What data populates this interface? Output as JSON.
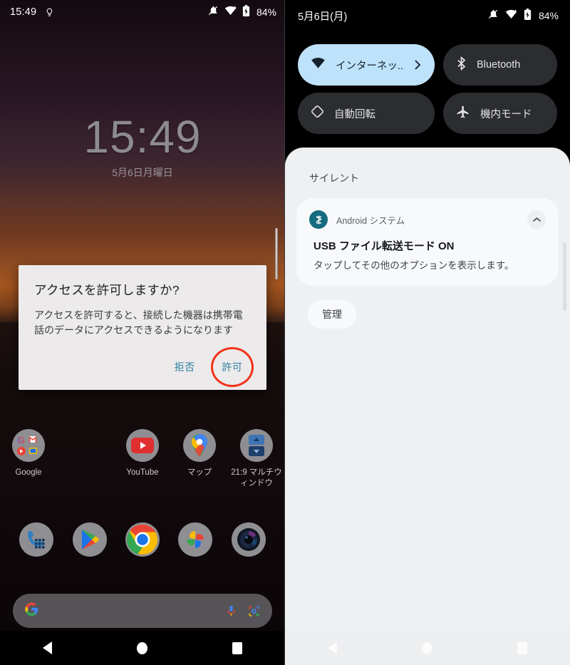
{
  "left_screen": {
    "status_bar": {
      "time": "15:49",
      "icons": [
        "bulb-icon",
        "notifications-off-icon",
        "wifi-icon",
        "battery-icon"
      ],
      "battery_percent": "84%"
    },
    "lock_clock": {
      "time": "15:49",
      "date": "5月6日月曜日"
    },
    "dialog": {
      "title": "アクセスを許可しますか?",
      "body": "アクセスを許可すると、接続した機器は携帯電話のデータにアクセスできるようになります",
      "deny_label": "拒否",
      "allow_label": "許可",
      "highlight_color": "#f4321a",
      "link_color": "#2d7fa3"
    },
    "apps": [
      {
        "label": "Google",
        "icon": "google-folder-icon"
      },
      {
        "label": "",
        "icon": "empty-slot"
      },
      {
        "label": "YouTube",
        "icon": "youtube-icon"
      },
      {
        "label": "マップ",
        "icon": "maps-icon"
      },
      {
        "label": "21:9 マルチウィンドウ",
        "icon": "multiwindow-icon"
      }
    ],
    "dock": [
      {
        "label": "電話",
        "icon": "phone-icon"
      },
      {
        "label": "Play ストア",
        "icon": "play-store-icon"
      },
      {
        "label": "Chrome",
        "icon": "chrome-icon"
      },
      {
        "label": "フォト",
        "icon": "photos-icon"
      },
      {
        "label": "カメラ",
        "icon": "camera-icon"
      }
    ],
    "search_bar": {
      "placeholder": "",
      "value": "",
      "icons": [
        "google-g-icon",
        "microphone-icon",
        "lens-icon"
      ]
    },
    "nav_bar": {
      "back": "戻る",
      "home": "ホーム",
      "recents": "履歴"
    }
  },
  "right_screen": {
    "status_bar": {
      "date": "5月6日(月)",
      "icons": [
        "notifications-off-icon",
        "wifi-icon",
        "battery-icon"
      ],
      "battery_percent": "84%"
    },
    "quick_settings": [
      {
        "label": "インターネッ..",
        "icon": "wifi-icon",
        "active": true,
        "chevron": true
      },
      {
        "label": "Bluetooth",
        "icon": "bluetooth-icon",
        "active": false,
        "chevron": false
      },
      {
        "label": "自動回転",
        "icon": "auto-rotate-icon",
        "active": false,
        "chevron": false
      },
      {
        "label": "機内モード",
        "icon": "airplane-icon",
        "active": false,
        "chevron": false
      }
    ],
    "notifications": {
      "section_header": "サイレント",
      "items": [
        {
          "app_name": "Android システム",
          "app_icon": "android-system-icon",
          "title": "USB ファイル転送モード ON",
          "text": "タップしてその他のオプションを表示します。",
          "collapse_icon": "chevron-up-icon"
        }
      ],
      "manage_label": "管理"
    },
    "nav_bar": {
      "back": "戻る",
      "home": "ホーム",
      "recents": "履歴"
    }
  }
}
